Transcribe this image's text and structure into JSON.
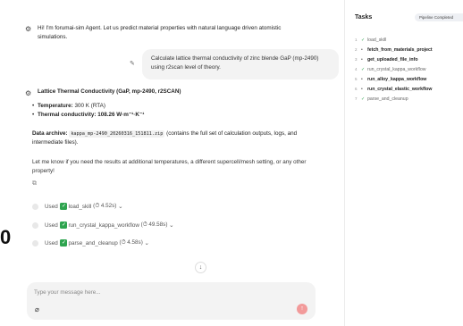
{
  "chat": {
    "greeting": "Hi! I'm forumai-sim Agent. Let us predict material properties with natural language driven atomistic simulations.",
    "user_message": "Calculate lattice thermal conductivity of zinc blende GaP (mp-2490) using r2scan level of theory.",
    "answer_title": "Lattice Thermal Conductivity (GaP, mp-2490, r2SCAN)",
    "temperature_label": "Temperature:",
    "temperature_value": "300 K (RTA)",
    "conductivity_label": "Thermal conductivity:",
    "conductivity_value": "108.26 W·m⁻¹·K⁻¹",
    "archive_label": "Data archive:",
    "archive_file": "kappa_mp-2490_20260316_151811.zip",
    "archive_note": "(contains the full set of calculation outputs, logs, and intermediate files).",
    "followup": "Let me know if you need the results at additional temperatures, a different supercell/mesh setting, or any other property!",
    "tool_calls": [
      {
        "prefix": "Used",
        "tool": "load_skill",
        "time": "(⏱ 4.52s)"
      },
      {
        "prefix": "Used",
        "tool": "run_crystal_kappa_workflow",
        "time": "(⏱ 49.58s)"
      },
      {
        "prefix": "Used",
        "tool": "parse_and_cleanup",
        "time": "(⏱ 4.58s)"
      }
    ]
  },
  "composer": {
    "placeholder": "Type your message here..."
  },
  "side_fragment": "0",
  "tasks": {
    "title": "Tasks",
    "badge": "Pipeline Completed",
    "items": [
      {
        "num": "1",
        "status": "done",
        "label": "load_skill"
      },
      {
        "num": "2",
        "status": "pending",
        "label": "fetch_from_materials_project"
      },
      {
        "num": "3",
        "status": "pending",
        "label": "get_uploaded_file_info"
      },
      {
        "num": "4",
        "status": "done",
        "label": "run_crystal_kappa_workflow"
      },
      {
        "num": "5",
        "status": "pending",
        "label": "run_alloy_kappa_workflow"
      },
      {
        "num": "6",
        "status": "pending",
        "label": "run_crystal_elastic_workflow"
      },
      {
        "num": "7",
        "status": "done",
        "label": "parse_and_cleanup"
      }
    ]
  },
  "icons": {
    "bot": "bot-icon",
    "edit": "pencil-icon",
    "copy": "copy-icon",
    "check": "check-icon",
    "attach": "paperclip-icon",
    "send": "send-icon",
    "scroll": "arrow-down-icon"
  }
}
